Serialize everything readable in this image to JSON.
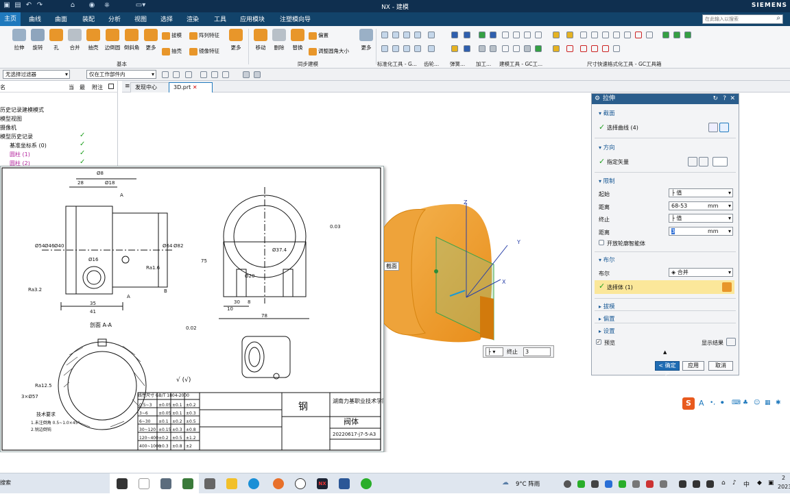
{
  "window": {
    "title": "NX - 建模",
    "brand": "SIEMENS"
  },
  "menu": {
    "items": [
      "主页",
      "曲线",
      "曲面",
      "装配",
      "分析",
      "视图",
      "选择",
      "渲染",
      "工具",
      "应用模块",
      "注塑模向导"
    ],
    "search_placeholder": "在此输入以搜索"
  },
  "ribbon": {
    "big_buttons": [
      "拉伸",
      "旋转",
      "孔",
      "合并",
      "抽壳",
      "边倒圆",
      "倒斜角",
      "更多",
      "移动",
      "删除",
      "替换",
      "更多"
    ],
    "small_buttons": [
      "拔模",
      "阵列特征",
      "抽壳",
      "镜像特征",
      "偏置",
      "调整圆角大小"
    ],
    "groups": [
      "基本",
      "同步建模",
      "标准化工具 - G...",
      "齿轮...",
      "弹簧...",
      "加工...",
      "建模工具 - GC工...",
      "尺寸快速格式化工具 - GC工具箱"
    ]
  },
  "filterbar": {
    "type_filter": "无选择过滤器",
    "scope": "仅在工作部件内"
  },
  "nav": {
    "col_headers": [
      "名",
      "当",
      "最",
      "附注"
    ],
    "rows": [
      "历史记录建模模式",
      "模型视图",
      "摄像机",
      "模型历史记录",
      "基准坐标系 (0)",
      "圆柱 (1)",
      "圆柱 (2)"
    ]
  },
  "tabs": [
    "发现中心",
    "3D.prt"
  ],
  "drawing": {
    "dims": [
      "Ø8",
      "28",
      "Ø18",
      "Ø54",
      "Ø46",
      "Ø40",
      "35",
      "41",
      "Ø16",
      "Ø64",
      "Ø82",
      "75",
      "30",
      "10",
      "8",
      "78",
      "Ra1.6",
      "Ra3.2",
      "Ra12.5",
      "A",
      "B",
      "0.02",
      "0.03",
      "Ø37.4",
      "Ø20",
      "3×Ø57"
    ],
    "section_label": "剖面 A-A",
    "notes": [
      "技术要求",
      "1.未注倒角 0.5~1.0×45°",
      "2.锐边倒钝"
    ],
    "material": "钢",
    "part_name": "阀体",
    "company": "湖南力基职业技术学院",
    "drawing_no": "20220617-j7-5-A3",
    "tol_title": "线性尺寸 GB/T 1804-2000",
    "tol_rows": [
      [
        "0.5~3",
        "±0.05",
        "±0.1",
        "±0.2"
      ],
      [
        "3~6",
        "±0.05",
        "±0.1",
        "±0.3"
      ],
      [
        "6~30",
        "±0.1",
        "±0.2",
        "±0.5"
      ],
      [
        "30~120",
        "±0.15",
        "±0.3",
        "±0.8"
      ],
      [
        "120~400",
        "±0.2",
        "±0.5",
        "±1.2"
      ],
      [
        "400~1000",
        "±0.3",
        "±0.8",
        "±2"
      ]
    ],
    "roughness": "√ (√)"
  },
  "viewport": {
    "section_label": "截面",
    "axes": [
      "Z",
      "Y",
      "X"
    ],
    "on_canvas": {
      "end_label": "终止",
      "end_value": "3"
    }
  },
  "dialog": {
    "title": "拉伸",
    "sections": [
      "截面",
      "方向",
      "限制",
      "布尔",
      "拔模",
      "偏置",
      "设置"
    ],
    "select_curve": "选择曲线 (4)",
    "specify_vector": "指定矢量",
    "start_label": "起始",
    "start_value": "值",
    "distance_label": "距离",
    "distance_value": "68-53",
    "unit": "mm",
    "end_label": "终止",
    "end_value": "值",
    "end_distance_label": "距离",
    "end_distance_value": "3",
    "open_profile": "开放轮廓智能体",
    "boolean_label": "布尔",
    "boolean_value": "合并",
    "select_body": "选择体 (1)",
    "preview": "预览",
    "show_result": "显示结果",
    "ok": "< 确定 >",
    "apply": "应用",
    "cancel": "取消"
  },
  "taskbar": {
    "search": "搜索",
    "weather": "9°C 阵雨",
    "clock_time": "2",
    "clock_date": "2023"
  },
  "colors": {
    "titlebar": "#0f2f4f",
    "menubar": "#12436a",
    "accent": "#1f79bd",
    "part": "#f0a02a"
  }
}
